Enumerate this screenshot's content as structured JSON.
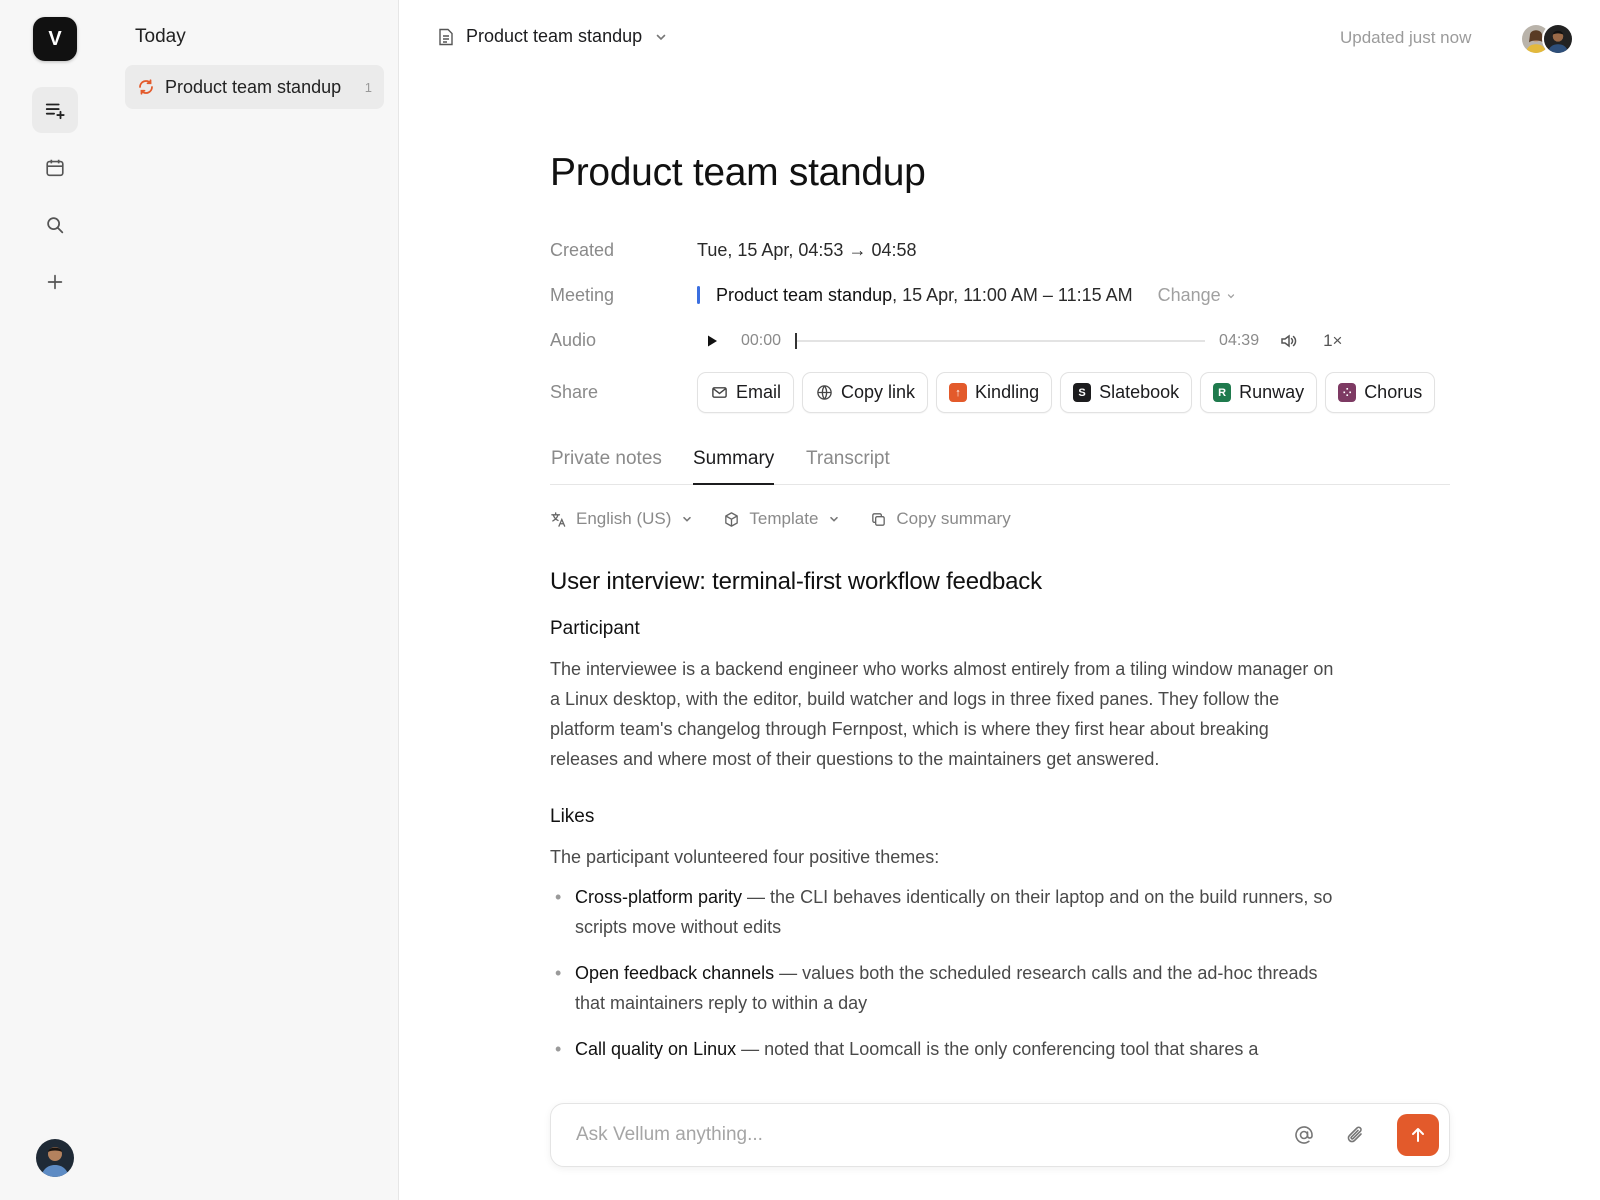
{
  "app": {
    "logo_letter": "V"
  },
  "sidebar": {
    "heading": "Today",
    "items": [
      {
        "label": "Product team standup",
        "count": "1"
      }
    ]
  },
  "topbar": {
    "title": "Product team standup",
    "updated": "Updated just now"
  },
  "doc": {
    "title": "Product team standup",
    "meta": {
      "created_label": "Created",
      "created_value": "Tue, 15 Apr, 04:53 → 04:58",
      "meeting_label": "Meeting",
      "meeting_name": "Product team standup",
      "meeting_time": ", 15 Apr, 11:00 AM – 11:15 AM",
      "change_label": "Change",
      "audio_label": "Audio",
      "audio_current": "00:00",
      "audio_total": "04:39",
      "audio_speed": "1×",
      "audio_progress": 0,
      "share_label": "Share"
    },
    "share_buttons": [
      {
        "label": "Email",
        "icon": "mail-icon"
      },
      {
        "label": "Copy link",
        "icon": "globe-icon"
      },
      {
        "label": "Kindling",
        "icon": "kindling-icon",
        "badge": "↑",
        "color": "#e35a2b"
      },
      {
        "label": "Slatebook",
        "icon": "slatebook-icon",
        "badge": "S",
        "color": "#1c1c1e"
      },
      {
        "label": "Runway",
        "icon": "runway-icon",
        "badge": "R",
        "color": "#1f7a4d"
      },
      {
        "label": "Chorus",
        "icon": "chorus-icon",
        "badge": "⁘",
        "color": "#7d3a63"
      }
    ],
    "tabs": [
      {
        "label": "Private notes"
      },
      {
        "label": "Summary",
        "active": true
      },
      {
        "label": "Transcript"
      }
    ],
    "toolbar": {
      "language": "English (US)",
      "template": "Template",
      "copy": "Copy summary"
    }
  },
  "summary": {
    "heading": "User interview: terminal-first workflow feedback",
    "participant_heading": "Participant",
    "participant_text": "The interviewee is a backend engineer who works almost entirely from a tiling window manager on a Linux desktop, with the editor, build watcher and logs in three fixed panes. They follow the platform team's changelog through Fernpost, which is where they first hear about breaking releases and where most of their questions to the maintainers get answered.",
    "likes_heading": "Likes",
    "likes_intro": "The participant volunteered four positive themes:",
    "likes": [
      {
        "title": "Cross-platform parity",
        "text": " — the CLI behaves identically on their laptop and on the build runners, so scripts move without edits"
      },
      {
        "title": "Open feedback channels",
        "text": " — values both the scheduled research calls and the ad-hoc threads that maintainers reply to within a day"
      },
      {
        "title": "Call quality on Linux",
        "text": " — noted that Loomcall is the only conferencing tool that shares a"
      }
    ]
  },
  "ask": {
    "placeholder": "Ask Vellum anything..."
  },
  "colors": {
    "accent": "#e35a2b",
    "meeting_bar": "#3b6fe0"
  }
}
